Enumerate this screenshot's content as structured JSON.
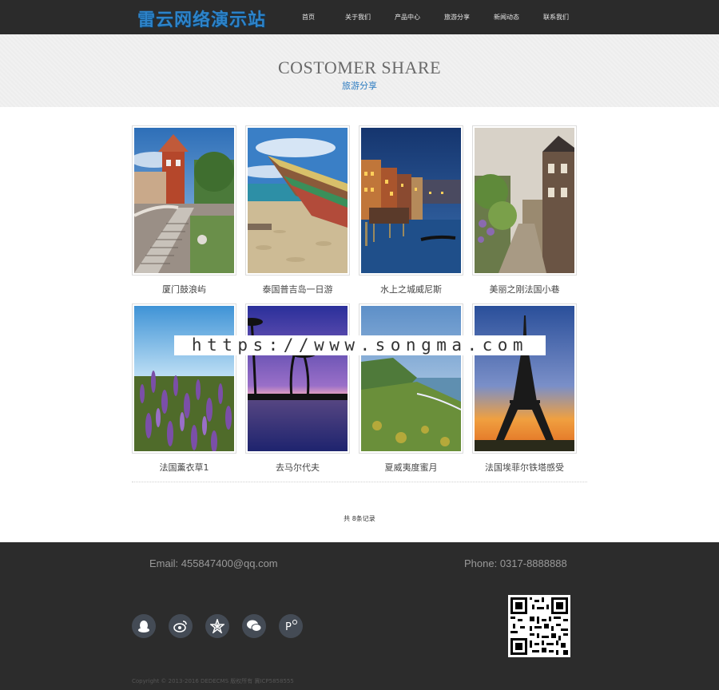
{
  "header": {
    "logo_text": "雷云网络演示站",
    "nav": [
      "首页",
      "关于我们",
      "产品中心",
      "旅游分享",
      "新闻动态",
      "联系我们"
    ]
  },
  "banner": {
    "title": "COSTOMER SHARE",
    "subtitle": "旅游分享"
  },
  "gallery": [
    {
      "caption": "厦门鼓浪屿",
      "scene": "castle-stairs"
    },
    {
      "caption": "泰国普吉岛一日游",
      "scene": "beach-boats"
    },
    {
      "caption": "水上之城威尼斯",
      "scene": "venice-night"
    },
    {
      "caption": "美丽之刚法国小巷",
      "scene": "french-alley"
    },
    {
      "caption": "法国薰衣草1",
      "scene": "lavender"
    },
    {
      "caption": "去马尔代夫",
      "scene": "maldives-sunset"
    },
    {
      "caption": "夏威夷度蜜月",
      "scene": "hawaii-coast"
    },
    {
      "caption": "法国埃菲尔铁塔感受",
      "scene": "eiffel-tower"
    }
  ],
  "pagination": {
    "record_text": "共 8条记录"
  },
  "watermark": "https://www.songma.com",
  "footer": {
    "email": "Email: 455847400@qq.com",
    "phone": "Phone: 0317-8888888",
    "socials": [
      "qq-icon",
      "weibo-icon",
      "star-icon",
      "wechat-icon",
      "tieba-icon"
    ],
    "copyright": "Copyright © 2013-2016 DEDECMS 版权所有 冀ICP5858555"
  },
  "colors": {
    "accent": "#2d7cc1",
    "header_bg": "#2b2b2b",
    "footer_bg": "#2c2c2c"
  }
}
